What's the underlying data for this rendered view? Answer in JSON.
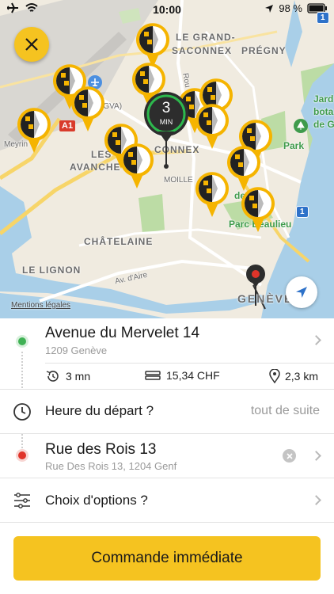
{
  "status_bar": {
    "time": "10:00",
    "battery": "98 %",
    "network_badge": "1"
  },
  "map": {
    "labels": {
      "grand_saconnex_1": "LE GRAND-",
      "grand_saconnex_2": "SACONNEX",
      "pregny": "PRÉGNY",
      "gva": "(GVA)",
      "a1": "A1",
      "meyrin": "Meyrin",
      "les": "LES",
      "avanchets": "AVANCHE",
      "connex": "CONNEX",
      "moille": "MOILLE",
      "chatelaine": "CHÂTELAINE",
      "lignon": "LE LIGNON",
      "av_aire": "Av. d'Aire",
      "geneve": "GENÈVE",
      "jardin_1": "Jard",
      "jardin_2": "bota",
      "jardin_3": "de G",
      "park": "Park",
      "parc_beaulieu": "Parc Beaulieu",
      "ge_ne": "de G    ne",
      "route": "Rou",
      "road_badge": "1",
      "road_badge_top": "1"
    },
    "eta_marker": {
      "value": "3",
      "unit": "MIN"
    },
    "legal_link": "Mentions légales",
    "accent_color": "#f5c320"
  },
  "pickup": {
    "address": "Avenue du Mervelet 14",
    "city": "1209 Genève"
  },
  "trip": {
    "duration": "3 mn",
    "price": "15,34 CHF",
    "distance": "2,3 km"
  },
  "departure": {
    "label": "Heure du départ ?",
    "value": "tout de suite"
  },
  "destination": {
    "address": "Rue des Rois 13",
    "detail": "Rue Des Rois 13, 1204 Genf"
  },
  "options": {
    "label": "Choix d'options ?"
  },
  "order_button": {
    "label": "Commande immédiate"
  }
}
